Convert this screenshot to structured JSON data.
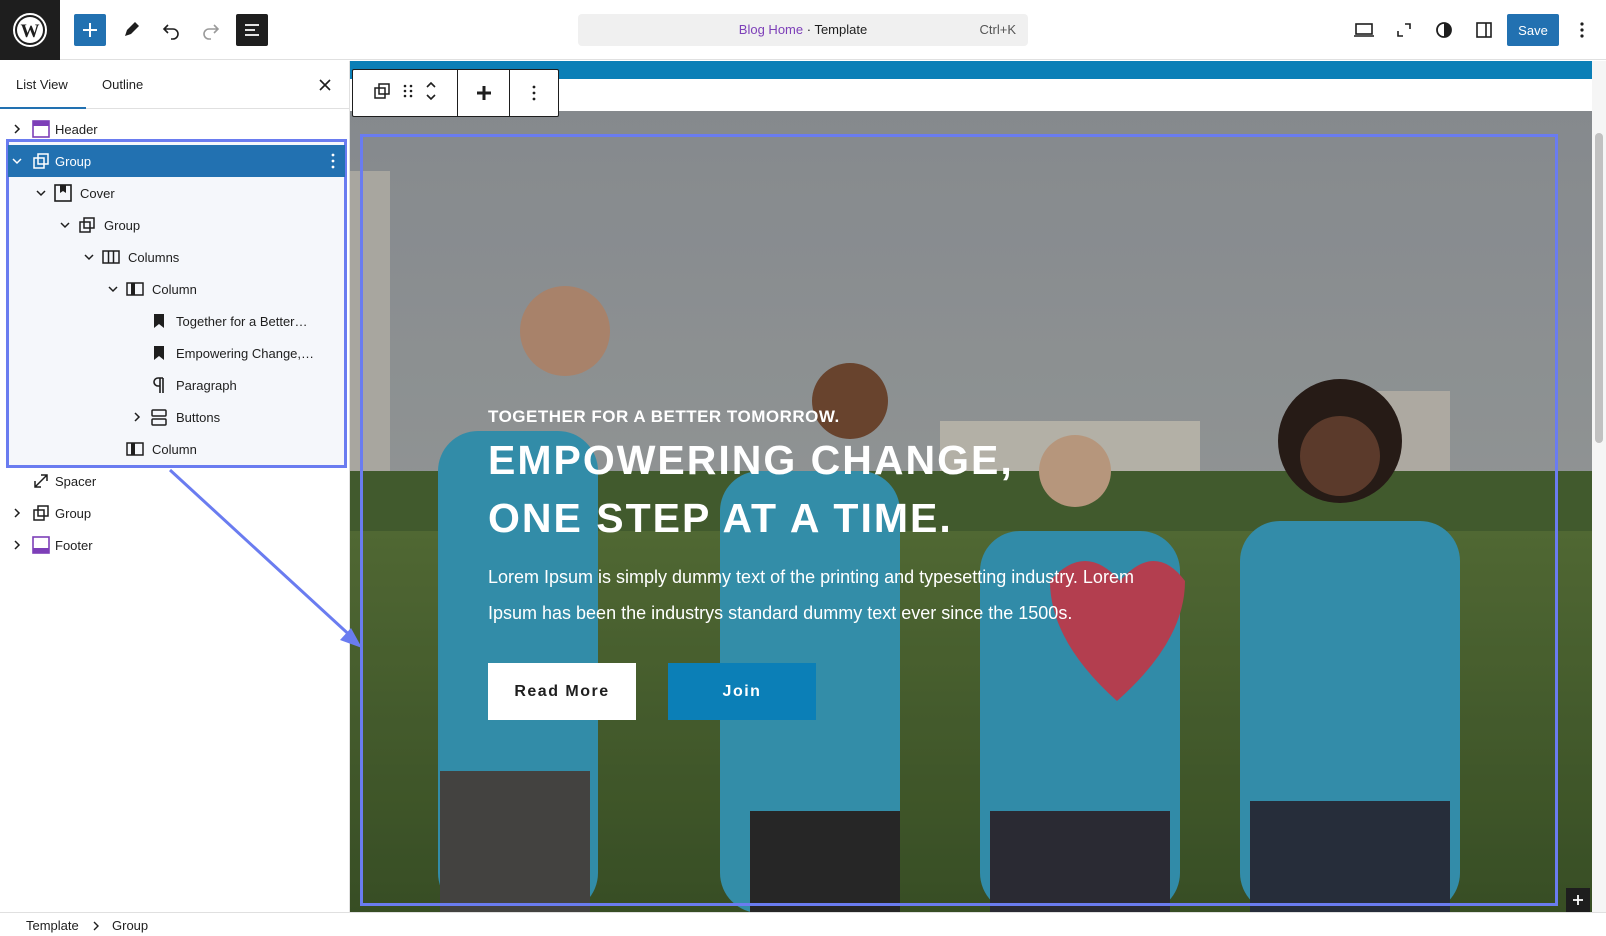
{
  "topbar": {
    "save_label": "Save",
    "command": {
      "template_name": "Blog Home",
      "separator": " · ",
      "template_kind": "Template",
      "shortcut": "Ctrl+K"
    }
  },
  "sidebar": {
    "tabs": [
      {
        "label": "List View"
      },
      {
        "label": "Outline"
      }
    ],
    "items": [
      {
        "label": "Header"
      },
      {
        "label": "Group"
      },
      {
        "label": "Cover"
      },
      {
        "label": "Group"
      },
      {
        "label": "Columns"
      },
      {
        "label": "Column"
      },
      {
        "label": "Together for a Better…"
      },
      {
        "label": "Empowering Change,…"
      },
      {
        "label": "Paragraph"
      },
      {
        "label": "Buttons"
      },
      {
        "label": "Column"
      },
      {
        "label": "Spacer"
      },
      {
        "label": "Group"
      },
      {
        "label": "Footer"
      }
    ]
  },
  "hero": {
    "kicker": "TOGETHER FOR A BETTER TOMORROW.",
    "headline_line1": "EMPOWERING CHANGE,",
    "headline_line2": "ONE STEP AT A TIME.",
    "body_line1": "Lorem Ipsum is simply dummy text of the printing and typesetting industry. Lorem",
    "body_line2": "Ipsum has been the industrys standard dummy text ever since the 1500s.",
    "read_more": "Read More",
    "join": "Join"
  },
  "breadcrumb": [
    {
      "label": "Template"
    },
    {
      "label": "Group"
    }
  ],
  "colors": {
    "accent": "#2271b1",
    "selection": "#6a7cf0",
    "hero_blue": "#0b7fb7",
    "template_purple": "#7d3fb8"
  },
  "icons": {
    "wordpress": "wordpress-icon",
    "add": "plus-icon",
    "edit": "pencil-icon",
    "undo": "undo-icon",
    "redo": "redo-icon",
    "document_overview": "list-view-icon",
    "desktop": "desktop-icon",
    "zoom_out": "zoom-out-icon",
    "styles": "contrast-icon",
    "settings": "sidebar-icon",
    "options": "more-vertical-icon"
  }
}
